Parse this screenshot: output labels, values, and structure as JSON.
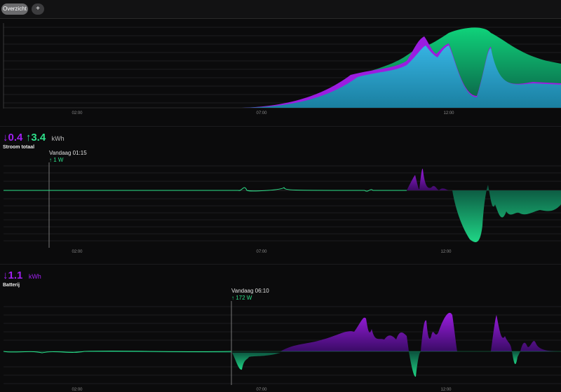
{
  "toolbar": {
    "overview_label": "Overzicht",
    "add_label": "+"
  },
  "x_ticks": [
    "02:00",
    "07:00",
    "12:00"
  ],
  "panel2": {
    "down_value": "0.4",
    "up_value": "3.4",
    "unit": "kWh",
    "title": "Stroom totaal",
    "tooltip_time": "Vandaag 01:15",
    "tooltip_value": "1 W"
  },
  "panel3": {
    "down_value": "1.1",
    "unit": "kWh",
    "title": "Batterij",
    "tooltip_time": "Vandaag 06:10",
    "tooltip_value": "172 W"
  },
  "colors": {
    "purple": "#9b1de0",
    "green": "#15c877",
    "blue": "#2aa9d8",
    "bg": "#0b0b0c"
  },
  "icons": {
    "down": "arrow-down-icon",
    "up": "arrow-up-icon"
  }
}
